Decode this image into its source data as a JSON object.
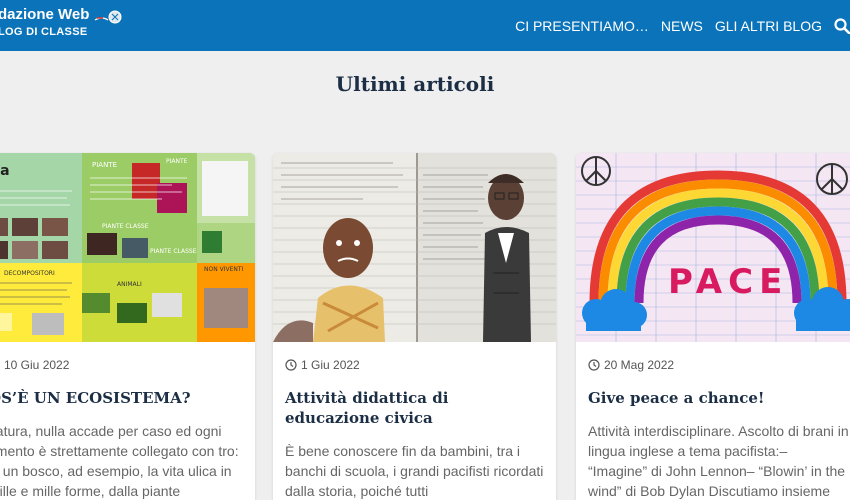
{
  "header": {
    "logo_title": "dazione Web",
    "logo_subtitle": "LOG DI CLASSE",
    "nav": [
      "CI PRESENTIAMO…",
      "NEWS",
      "GLI ALTRI BLOG"
    ]
  },
  "section": {
    "title": "Ultimi articoli"
  },
  "cards": [
    {
      "date": "10 Giu 2022",
      "title": "OS’È UN ECOSISTEMA?",
      "excerpt": "natura, nulla accade per caso ed ogni emento è strettamente collegato con tro: in un bosco, ad esempio, la vita ulica in mille e mille forme, dalla piante"
    },
    {
      "date": "1 Giu 2022",
      "title": "Attività didattica di educazione civica",
      "excerpt": "È bene conoscere fin da bambini, tra i banchi di scuola, i grandi pacifisti ricordati dalla storia, poiché tutti"
    },
    {
      "date": "20 Mag 2022",
      "title": "Give peace a chance!",
      "excerpt": "Attività interdisciplinare. Ascolto di brani in lingua inglese a tema pacifista:– “Imagine” di John Lennon– “Blowin’ in the wind” di Bob Dylan Discutiamo insieme"
    }
  ],
  "image_texts": {
    "ecosystem": [
      "ema",
      "PIANTE",
      "PIANTE",
      "PIANTE CLASSE",
      "PIANTE CLASSE",
      "ANIMALI",
      "DECOMPOSITORI",
      "NON VIVENTI"
    ],
    "peace": "PACE"
  },
  "colors": {
    "header": "#0a73b9",
    "title": "#1c2e44",
    "text": "#666666",
    "background": "#efefef"
  }
}
